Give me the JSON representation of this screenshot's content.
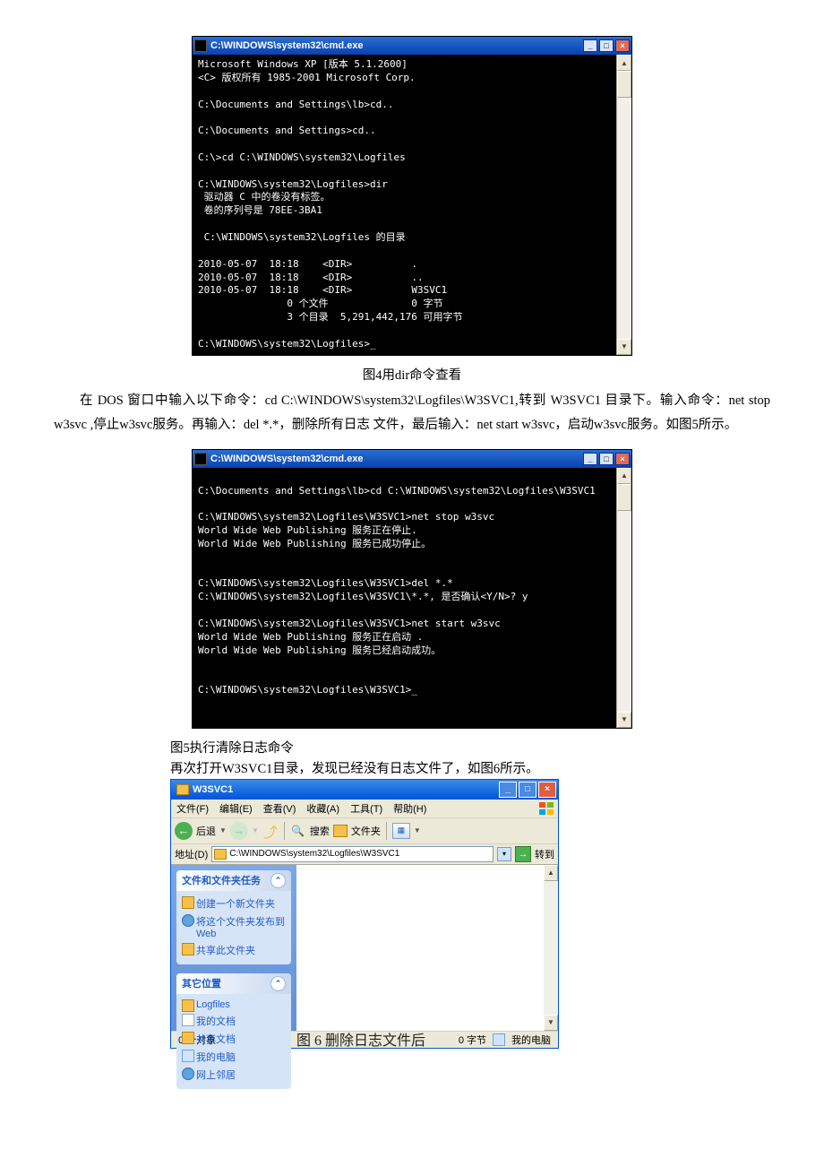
{
  "cmd1": {
    "title": "C:\\WINDOWS\\system32\\cmd.exe",
    "body": "Microsoft Windows XP [版本 5.1.2600]\n<C> 版权所有 1985-2001 Microsoft Corp.\n\nC:\\Documents and Settings\\lb>cd..\n\nC:\\Documents and Settings>cd..\n\nC:\\>cd C:\\WINDOWS\\system32\\Logfiles\n\nC:\\WINDOWS\\system32\\Logfiles>dir\n 驱动器 C 中的卷没有标签。\n 卷的序列号是 78EE-3BA1\n\n C:\\WINDOWS\\system32\\Logfiles 的目录\n\n2010-05-07  18:18    <DIR>          .\n2010-05-07  18:18    <DIR>          ..\n2010-05-07  18:18    <DIR>          W3SVC1\n               0 个文件              0 字节\n               3 个目录  5,291,442,176 可用字节\n\nC:\\WINDOWS\\system32\\Logfiles>_"
  },
  "caption1": "图4用dir命令查看",
  "paragraph1": "在   DOS   窗口中输入以下命令：cd  C:\\WINDOWS\\system32\\Logfiles\\W3SVC1,转到 W3SVC1 目录下。输入命令：net stop w3svc ,停止w3svc服务。再输入：del *.*，删除所有日志 文件，最后输入：net start w3svc，启动w3svc服务。如图5所示。",
  "cmd2": {
    "title": "C:\\WINDOWS\\system32\\cmd.exe",
    "body": "\nC:\\Documents and Settings\\lb>cd C:\\WINDOWS\\system32\\Logfiles\\W3SVC1\n\nC:\\WINDOWS\\system32\\Logfiles\\W3SVC1>net stop w3svc\nWorld Wide Web Publishing 服务正在停止.\nWorld Wide Web Publishing 服务已成功停止。\n\n\nC:\\WINDOWS\\system32\\Logfiles\\W3SVC1>del *.*\nC:\\WINDOWS\\system32\\Logfiles\\W3SVC1\\*.*, 是否确认<Y/N>? y\n\nC:\\WINDOWS\\system32\\Logfiles\\W3SVC1>net start w3svc\nWorld Wide Web Publishing 服务正在启动 .\nWorld Wide Web Publishing 服务已经启动成功。\n\n\nC:\\WINDOWS\\system32\\Logfiles\\W3SVC1>_\n\n\n"
  },
  "caption2": "图5执行清除日志命令",
  "paragraph2": "再次打开W3SVC1目录，发现已经没有日志文件了，如图6所示。",
  "explorer": {
    "title": "W3SVC1",
    "menu": {
      "file": "文件(F)",
      "edit": "编辑(E)",
      "view": "查看(V)",
      "fav": "收藏(A)",
      "tools": "工具(T)",
      "help": "帮助(H)"
    },
    "toolbar": {
      "back": "后退",
      "search": "搜索",
      "folders": "文件夹"
    },
    "addr_label": "地址(D)",
    "addr_path": "C:\\WINDOWS\\system32\\Logfiles\\W3SVC1",
    "go": "转到",
    "panel1": {
      "title": "文件和文件夹任务",
      "link1": "创建一个新文件夹",
      "link2": "将这个文件夹发布到 Web",
      "link3": "共享此文件夹"
    },
    "panel2": {
      "title": "其它位置",
      "link1": "Logfiles",
      "link2": "我的文档",
      "link3": "共享文档",
      "link4": "我的电脑",
      "link5": "网上邻居"
    },
    "status_left": "0 个对象",
    "status_bytes": "0 字节",
    "status_right": "我的电脑"
  },
  "caption3": "图 6  删除日志文件后",
  "win_ctrl": {
    "min": "_",
    "max": "□",
    "close": "×"
  }
}
